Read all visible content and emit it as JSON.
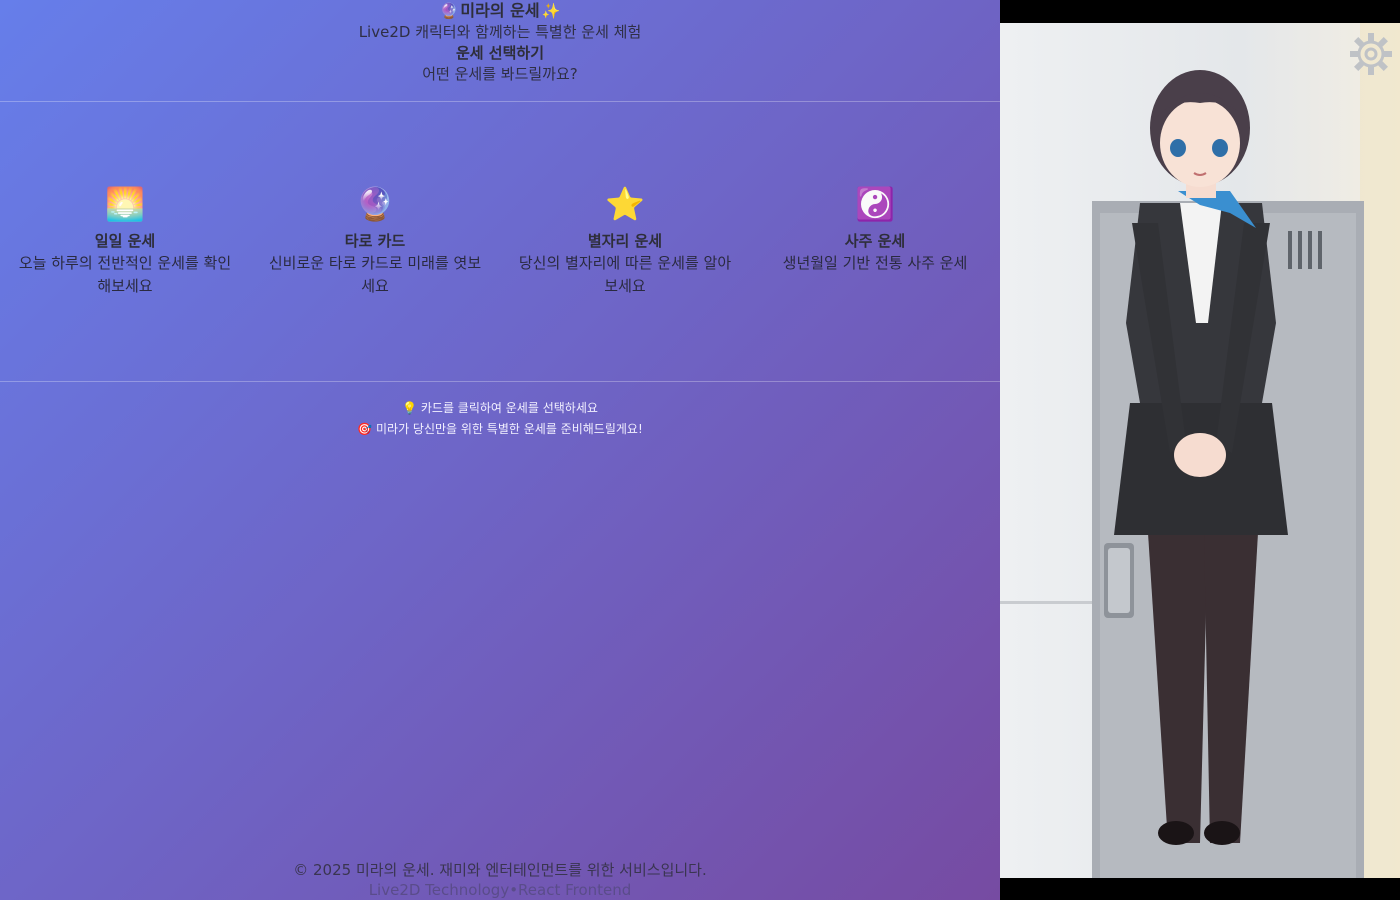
{
  "header": {
    "title_icon_left": "🔮",
    "title": "미라의 운세",
    "title_icon_right": "✨",
    "subtitle": "Live2D 캐릭터와 함께하는 특별한 운세 체험",
    "select_title": "운세 선택하기",
    "select_subtitle": "어떤 운세를 봐드릴까요?"
  },
  "cards": [
    {
      "icon": "🌅",
      "icon_name": "sunrise-icon",
      "name": "일일 운세",
      "desc": "오늘 하루의 전반적인 운세를 확인해보세요"
    },
    {
      "icon": "🔮",
      "icon_name": "crystal-ball-icon",
      "name": "타로 카드",
      "desc": "신비로운 타로 카드로 미래를 엿보세요"
    },
    {
      "icon": "⭐",
      "icon_name": "star-icon",
      "name": "별자리 운세",
      "desc": "당신의 별자리에 따른 운세를 알아보세요"
    },
    {
      "icon": "☯️",
      "icon_name": "yin-yang-icon",
      "name": "사주 운세",
      "desc": "생년월일 기반 전통 사주 운세"
    }
  ],
  "hints": {
    "hint1_icon": "💡",
    "hint1": "카드를 클릭하여 운세를 선택하세요",
    "hint2_icon": "🎯",
    "hint2": "미라가 당신만을 위한 특별한 운세를 준비해드릴게요!"
  },
  "footer": {
    "copyright": "© 2025 미라의 운세. 재미와 엔터테인먼트를 위한 서비스입니다.",
    "tech": "Live2D Technology•React Frontend"
  },
  "settings": {
    "icon_name": "gear-icon"
  },
  "colors": {
    "gradient_start": "#667eea",
    "gradient_end": "#764ba2"
  }
}
